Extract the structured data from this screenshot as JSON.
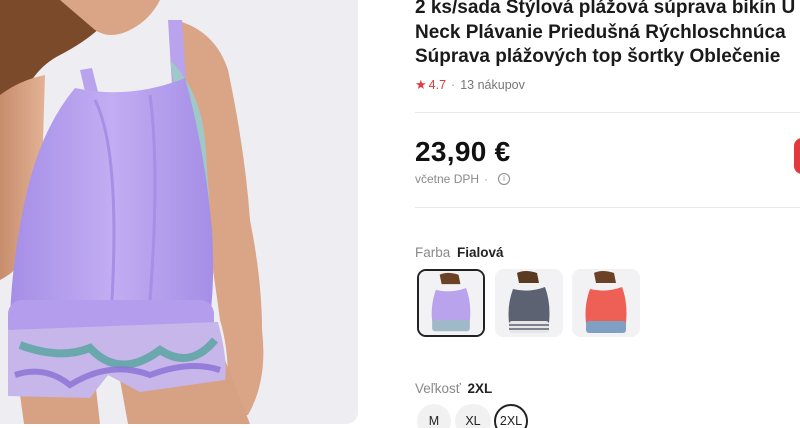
{
  "product": {
    "title_lines": [
      "2 ks/sada Štýlová plážová súprava bikín U",
      "Neck Plávanie Priedušná Rýchloschnúca",
      "Súprava plážových top šortky Oblečenie"
    ],
    "rating": "4.7",
    "purchases": "13 nákupov",
    "price": "23,90 €",
    "vat_note": "včetne DPH",
    "vat_separator": "·",
    "rating_separator": "·",
    "info_icon_glyph": "i"
  },
  "color_option": {
    "label": "Farba",
    "selected": "Fialová",
    "swatches": [
      {
        "name": "Fialová",
        "top": "#b9a3ec",
        "shorts": "#9fb9c9"
      },
      {
        "name": "Sivá",
        "top": "#5c6272",
        "shorts": "#e6e6e6"
      },
      {
        "name": "Červená",
        "top": "#ee5f55",
        "shorts": "#7f9fc3"
      }
    ]
  },
  "size_option": {
    "label": "Veľkosť",
    "selected": "2XL",
    "sizes": [
      "M",
      "XL",
      "2XL"
    ]
  },
  "icons": {
    "star": "star-icon",
    "info": "info-icon"
  },
  "colors": {
    "accent": "#e4393c",
    "hero_background": "#eeeef2",
    "tankini_purple": "#b8a2ee"
  }
}
